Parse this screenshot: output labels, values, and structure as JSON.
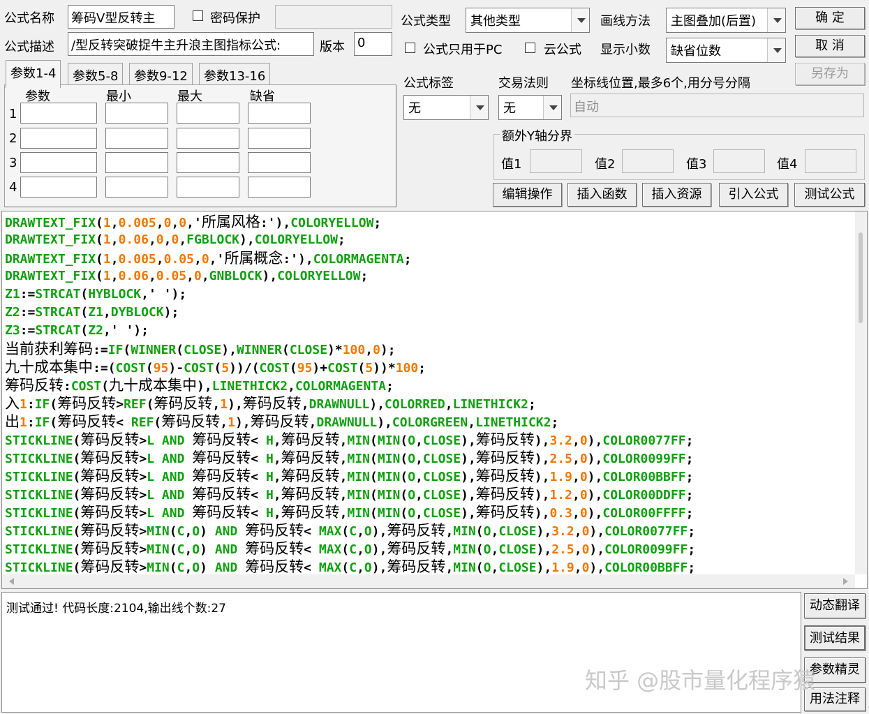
{
  "form": {
    "name_label": "公式名称",
    "name_value": "筹码V型反转主",
    "password_label": "密码保护",
    "desc_label": "公式描述",
    "desc_value": "/型反转突破捉牛主升浪主图指标公式:",
    "version_label": "版本",
    "version_value": "0",
    "type_label": "公式类型",
    "type_value": "其他类型",
    "draw_label": "画线方法",
    "draw_value": "主图叠加(后置)",
    "pc_only_label": "公式只用于PC",
    "cloud_label": "云公式",
    "decimal_label": "显示小数",
    "decimal_value": "缺省位数",
    "tag_label": "公式标签",
    "tag_value": "无",
    "trade_label": "交易法则",
    "trade_value": "无",
    "coord_label": "坐标线位置,最多6个,用分号分隔",
    "coord_placeholder": "自动",
    "extra_axis_label": "额外Y轴分界",
    "val1": "值1",
    "val2": "值2",
    "val3": "值3",
    "val4": "值4"
  },
  "buttons": {
    "ok": "确  定",
    "cancel": "取  消",
    "save_as": "另存为",
    "edit_ops": "编辑操作",
    "insert_func": "插入函数",
    "insert_res": "插入资源",
    "import_formula": "引入公式",
    "test_formula": "测试公式",
    "dynamic_translate": "动态翻译",
    "test_result": "测试结果",
    "param_wizard": "参数精灵",
    "usage_note": "用法注释"
  },
  "tabs": [
    "参数1-4",
    "参数5-8",
    "参数9-12",
    "参数13-16"
  ],
  "param_headers": [
    "参数",
    "最小",
    "最大",
    "缺省"
  ],
  "param_rows": [
    "1",
    "2",
    "3",
    "4"
  ],
  "code_lines": [
    "DRAWTEXT_FIX(1,0.005,0,0,'所属风格:'),COLORYELLOW;",
    "DRAWTEXT_FIX(1,0.06,0,0,FGBLOCK),COLORYELLOW;",
    "DRAWTEXT_FIX(1,0.005,0.05,0,'所属概念:'),COLORMAGENTA;",
    "DRAWTEXT_FIX(1,0.06,0.05,0,GNBLOCK),COLORYELLOW;",
    "Z1:=STRCAT(HYBLOCK,' ');",
    "Z2:=STRCAT(Z1,DYBLOCK);",
    "Z3:=STRCAT(Z2,' ');",
    "当前获利筹码:=IF(WINNER(CLOSE),WINNER(CLOSE)*100,0);",
    "九十成本集中:=(COST(95)-COST(5))/(COST(95)+COST(5))*100;",
    "筹码反转:COST(九十成本集中),LINETHICK2,COLORMAGENTA;",
    "入1:IF(筹码反转>REF(筹码反转,1),筹码反转,DRAWNULL),COLORRED,LINETHICK2;",
    "出1:IF(筹码反转< REF(筹码反转,1),筹码反转,DRAWNULL),COLORGREEN,LINETHICK2;",
    "STICKLINE(筹码反转>L AND 筹码反转< H,筹码反转,MIN(MIN(O,CLOSE),筹码反转),3.2,0),COLOR0077FF;",
    "STICKLINE(筹码反转>L AND 筹码反转< H,筹码反转,MIN(MIN(O,CLOSE),筹码反转),2.5,0),COLOR0099FF;",
    "STICKLINE(筹码反转>L AND 筹码反转< H,筹码反转,MIN(MIN(O,CLOSE),筹码反转),1.9,0),COLOR00BBFF;",
    "STICKLINE(筹码反转>L AND 筹码反转< H,筹码反转,MIN(MIN(O,CLOSE),筹码反转),1.2,0),COLOR00DDFF;",
    "STICKLINE(筹码反转>L AND 筹码反转< H,筹码反转,MIN(MIN(O,CLOSE),筹码反转),0.3,0),COLOR00FFFF;",
    "STICKLINE(筹码反转>MIN(C,O) AND 筹码反转< MAX(C,O),筹码反转,MIN(O,CLOSE),3.2,0),COLOR0077FF;",
    "STICKLINE(筹码反转>MIN(C,O) AND 筹码反转< MAX(C,O),筹码反转,MIN(O,CLOSE),2.5,0),COLOR0099FF;",
    "STICKLINE(筹码反转>MIN(C,O) AND 筹码反转< MAX(C,O),筹码反转,MIN(O,CLOSE),1.9,0),COLOR00BBFF;"
  ],
  "output_text": "测试通过! 代码长度:2104,输出线个数:27",
  "watermark": "知乎 @股市量化程序猿",
  "colors": {
    "code_green": "#10a010",
    "number_orange": "#f07800"
  }
}
